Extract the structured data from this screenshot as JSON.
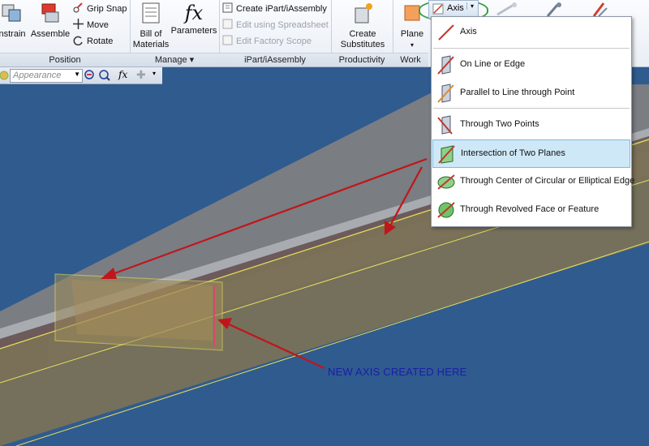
{
  "ribbon": {
    "position": {
      "title": "Position",
      "constrain": "nstrain",
      "assemble": "Assemble",
      "grip_snap": "Grip Snap",
      "move": "Move",
      "rotate": "Rotate"
    },
    "manage": {
      "title": "Manage",
      "bom": "Bill of Materials",
      "bom_l1": "Bill of",
      "bom_l2": "Materials",
      "parameters": "Parameters"
    },
    "ipart": {
      "title": "iPart/iAssembly",
      "create": "Create iPart/iAssembly",
      "edit_spreadsheet": "Edit using Spreadsheet",
      "edit_factory": "Edit Factory Scope"
    },
    "productivity": {
      "title": "Productivity",
      "create_substitutes_l1": "Create",
      "create_substitutes_l2": "Substitutes"
    },
    "work": {
      "title": "Work",
      "plane": "Plane",
      "axis": "Axis"
    }
  },
  "quickbar": {
    "appearance_placeholder": "Appearance"
  },
  "axis_menu": {
    "items": [
      {
        "label": "Axis"
      },
      {
        "label": "On Line or Edge"
      },
      {
        "label": "Parallel to Line  through Point"
      },
      {
        "label": "Through Two Points"
      },
      {
        "label": "Intersection of Two Planes"
      },
      {
        "label": "Through Center of Circular or Elliptical Edge"
      },
      {
        "label": "Through Revolved Face or Feature"
      }
    ],
    "highlighted": "Intersection of Two Planes"
  },
  "annotation": "NEW AXIS CREATED HERE",
  "colors": {
    "viewport_bg": "#2f5b8f",
    "highlight": "#cfe8f7",
    "arrow": "#c0161b",
    "annotation_text": "#1c1ca8",
    "green_ring": "#2fa043"
  }
}
